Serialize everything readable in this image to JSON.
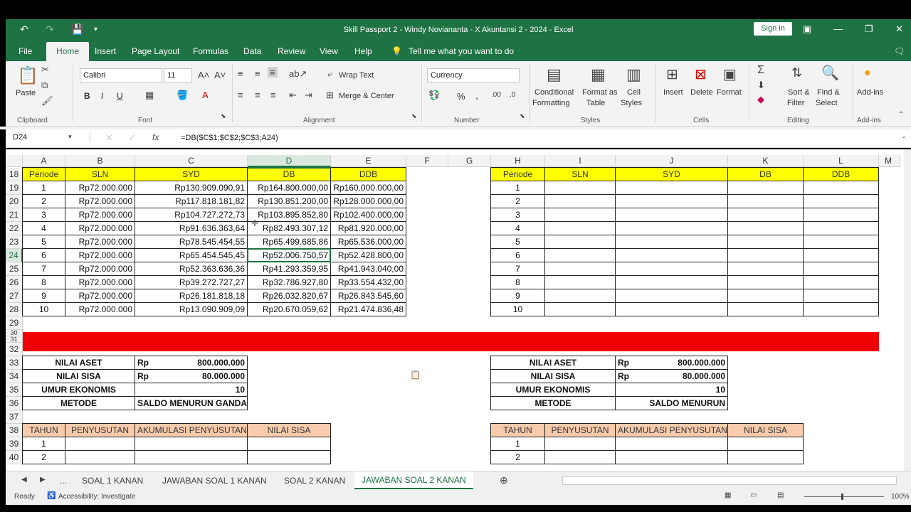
{
  "window": {
    "title": "Skill Passport 2 - Windy Noviananta - X Akuntansi 2 - 2024  -  Excel",
    "signin": "Sign in"
  },
  "ribbon_tabs": [
    "File",
    "Home",
    "Insert",
    "Page Layout",
    "Formulas",
    "Data",
    "Review",
    "View",
    "Help"
  ],
  "tell_me": "Tell me what you want to do",
  "ribbon": {
    "paste": "Paste",
    "clipboard": "Clipboard",
    "font_name": "Calibri",
    "font_size": "11",
    "font": "Font",
    "bold": "B",
    "italic": "I",
    "underline": "U",
    "wrap_text": "Wrap Text",
    "merge_center": "Merge & Center",
    "alignment": "Alignment",
    "number_format": "Currency",
    "percent": "%",
    "comma": ",",
    "number": "Number",
    "conditional_formatting_1": "Conditional",
    "conditional_formatting_2": "Formatting",
    "format_as_table_1": "Format as",
    "format_as_table_2": "Table",
    "cell_styles_1": "Cell",
    "cell_styles_2": "Styles",
    "styles": "Styles",
    "insert": "Insert",
    "delete": "Delete",
    "format": "Format",
    "cells": "Cells",
    "sort_filter_1": "Sort &",
    "sort_filter_2": "Filter",
    "find_select_1": "Find &",
    "find_select_2": "Select",
    "editing": "Editing",
    "addins": "Add-ins",
    "addins_group": "Add-ins"
  },
  "formula_bar": {
    "name_box": "D24",
    "fx": "fx",
    "formula": "=DB($C$1;$C$2;$C$3;A24)"
  },
  "columns_left": [
    "A",
    "B",
    "C",
    "D",
    "E",
    "F",
    "G"
  ],
  "columns_right": [
    "H",
    "I",
    "J",
    "K",
    "L"
  ],
  "col_m": "M",
  "rows": [
    "18",
    "19",
    "20",
    "21",
    "22",
    "23",
    "24",
    "25",
    "26",
    "27",
    "28",
    "29",
    "30",
    "31",
    "32",
    "33",
    "34",
    "35",
    "36",
    "37",
    "38",
    "39",
    "40"
  ],
  "table1": {
    "headers": [
      "Periode",
      "SLN",
      "SYD",
      "DB",
      "DDB"
    ],
    "rows": [
      [
        "1",
        "Rp72.000.000",
        "Rp130.909.090,91",
        "Rp164.800.000,00",
        "Rp160.000.000,00"
      ],
      [
        "2",
        "Rp72.000.000",
        "Rp117.818.181,82",
        "Rp130.851.200,00",
        "Rp128.000.000,00"
      ],
      [
        "3",
        "Rp72.000.000",
        "Rp104.727.272,73",
        "Rp103.895.852,80",
        "Rp102.400.000,00"
      ],
      [
        "4",
        "Rp72.000.000",
        "Rp91.636.363,64",
        "Rp82.493.307,12",
        "Rp81.920.000,00"
      ],
      [
        "5",
        "Rp72.000.000",
        "Rp78.545.454,55",
        "Rp65.499.685,86",
        "Rp65.536.000,00"
      ],
      [
        "6",
        "Rp72.000.000",
        "Rp65.454.545,45",
        "Rp52.006.750,57",
        "Rp52.428.800,00"
      ],
      [
        "7",
        "Rp72.000.000",
        "Rp52.363.636,36",
        "Rp41.293.359,95",
        "Rp41.943.040,00"
      ],
      [
        "8",
        "Rp72.000.000",
        "Rp39.272.727,27",
        "Rp32.786.927,80",
        "Rp33.554.432,00"
      ],
      [
        "9",
        "Rp72.000.000",
        "Rp26.181.818,18",
        "Rp26.032.820,67",
        "Rp26.843.545,60"
      ],
      [
        "10",
        "Rp72.000.000",
        "Rp13.090.909,09",
        "Rp20.670.059,62",
        "Rp21.474.836,48"
      ]
    ]
  },
  "table2": {
    "headers": [
      "Periode",
      "SLN",
      "SYD",
      "DB",
      "DDB"
    ],
    "periods": [
      "1",
      "2",
      "3",
      "4",
      "5",
      "6",
      "7",
      "8",
      "9",
      "10"
    ]
  },
  "info_left": {
    "labels": [
      "NILAI ASET",
      "NILAI SISA",
      "UMUR EKONOMIS",
      "METODE"
    ],
    "currency": "Rp",
    "values": [
      "800.000.000",
      "80.000.000",
      "10",
      "SALDO MENURUN GANDA"
    ]
  },
  "info_right": {
    "labels": [
      "NILAI ASET",
      "NILAI SISA",
      "UMUR EKONOMIS",
      "METODE"
    ],
    "currency": "Rp",
    "values": [
      "800.000.000",
      "80.000.000",
      "10",
      "SALDO MENURUN"
    ]
  },
  "dep_table": {
    "headers": [
      "TAHUN",
      "PENYUSUTAN",
      "AKUMULASI PENYUSUTAN",
      "NILAI SISA"
    ],
    "years": [
      "1",
      "2"
    ]
  },
  "sheet_tabs": [
    "...",
    "SOAL 1 KANAN",
    "JAWABAN SOAL 1 KANAN",
    "SOAL 2 KANAN",
    "JAWABAN SOAL 2 KANAN"
  ],
  "status": {
    "ready": "Ready",
    "accessibility": "Accessibility: Investigate",
    "zoom": "100%"
  },
  "colors": {
    "excel_green": "#1f7244",
    "header_yellow": "#ffff00",
    "band_red": "#f00000",
    "table_peach": "#f8cbad"
  }
}
